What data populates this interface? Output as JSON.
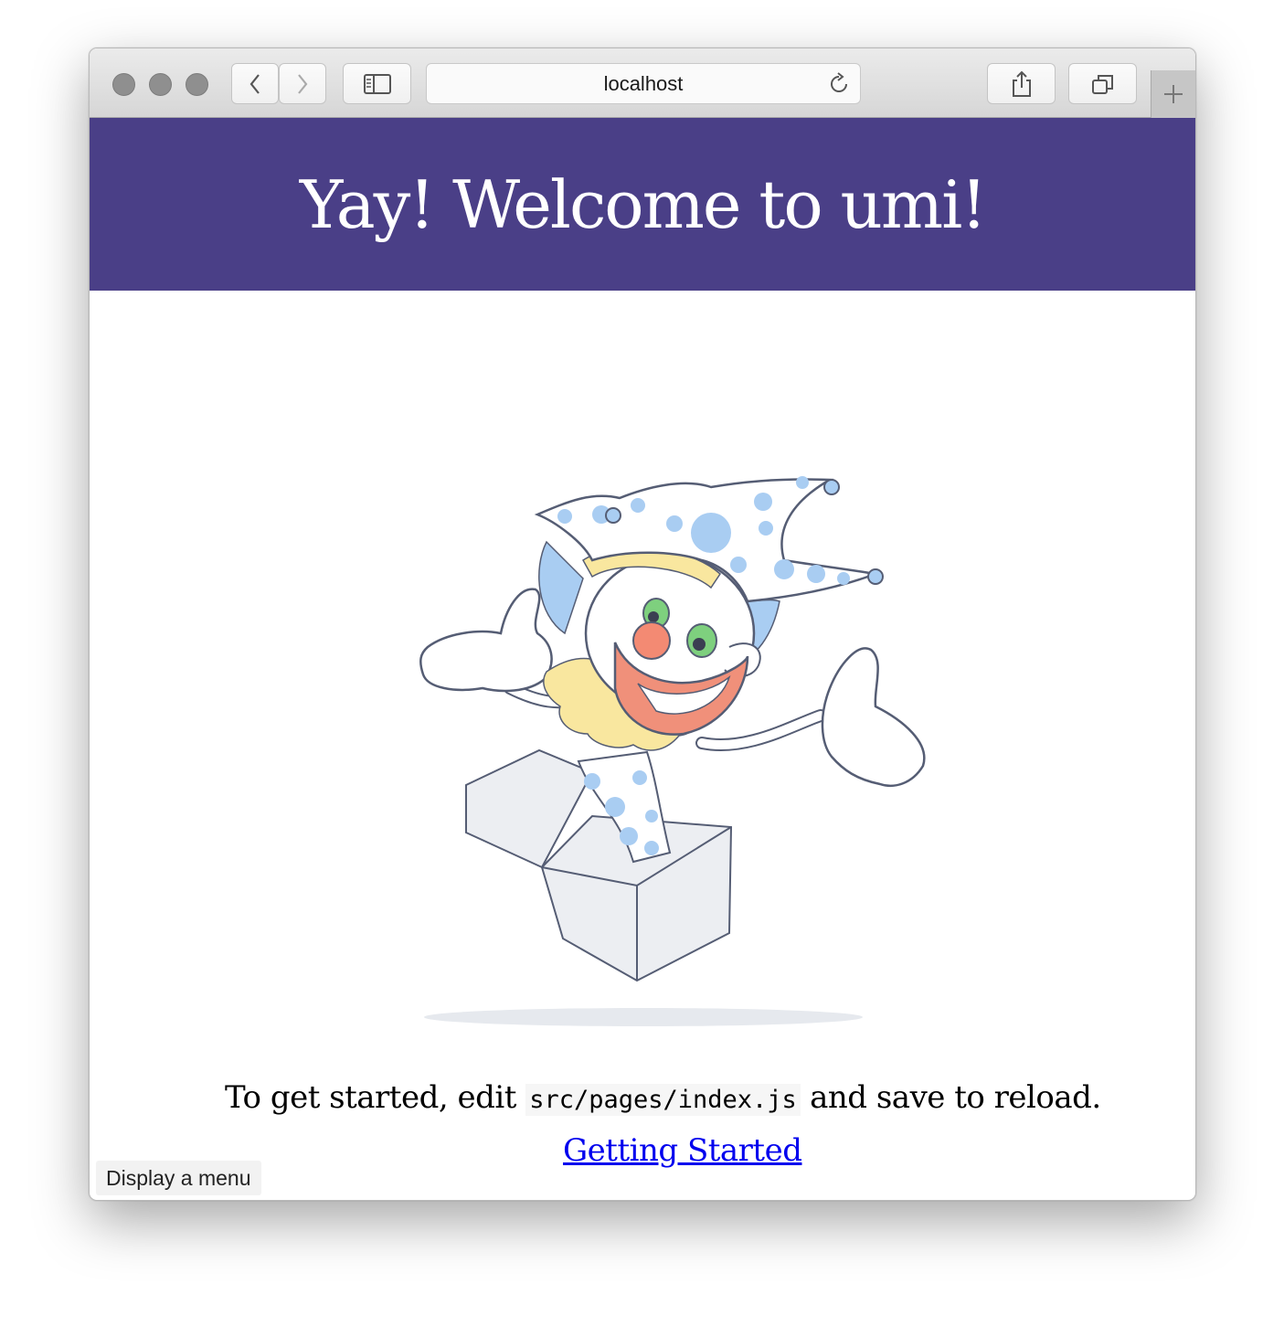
{
  "browser": {
    "address": "localhost",
    "icons": {
      "back": "chevron-left-icon",
      "forward": "chevron-right-icon",
      "sidebar": "sidebar-icon",
      "reload": "reload-icon",
      "share": "share-icon",
      "tabs": "tabs-overview-icon",
      "new_tab": "plus-icon"
    }
  },
  "page": {
    "heading": "Yay! Welcome to umi!",
    "illustration": "jack-in-the-box-clown-illustration",
    "instruction_before": "To get started, edit ",
    "instruction_code": "src/pages/index.js",
    "instruction_after": " and save to reload.",
    "link_label": "Getting Started"
  },
  "status_bar": {
    "text": "Display a menu"
  },
  "colors": {
    "header_bg": "#4a3f87",
    "link": "#0000ee"
  }
}
